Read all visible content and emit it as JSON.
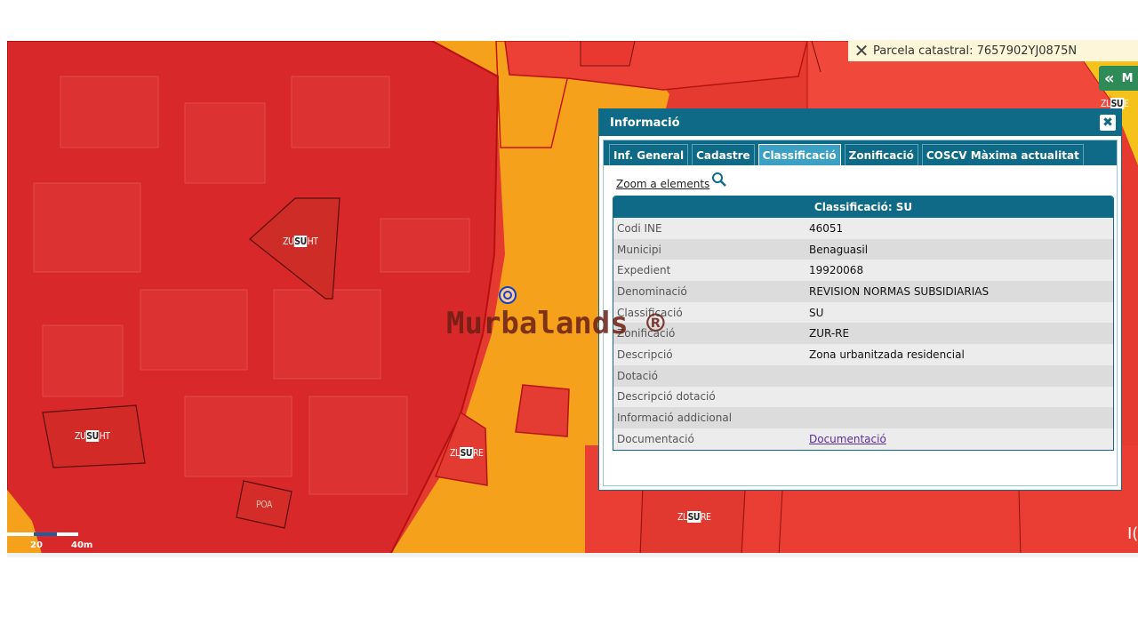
{
  "parcel_bar": {
    "label": "Parcela catastral: 7657902YJ0875N"
  },
  "panel_toggle": {
    "label": "M"
  },
  "info": {
    "title": "Informació",
    "tabs": [
      {
        "label": "Inf. General",
        "active": false
      },
      {
        "label": "Cadastre",
        "active": false
      },
      {
        "label": "Classificació",
        "active": true
      },
      {
        "label": "Zonificació",
        "active": false
      },
      {
        "label": "COSCV Màxima actualitat",
        "active": false
      }
    ],
    "zoom_link": "Zoom a elements",
    "table_header": {
      "prefix": "Classificació:",
      "value": "SU"
    },
    "rows": [
      {
        "key": "Codi INE",
        "value": "46051"
      },
      {
        "key": "Municipi",
        "value": "Benaguasil"
      },
      {
        "key": "Expedient",
        "value": "19920068"
      },
      {
        "key": "Denominació",
        "value": "REVISION NORMAS SUBSIDIARIAS"
      },
      {
        "key": "Classificació",
        "value": "SU"
      },
      {
        "key": "Zonificació",
        "value": "ZUR-RE"
      },
      {
        "key": "Descripció",
        "value": "Zona urbanitzada residencial"
      },
      {
        "key": "Dotació",
        "value": ""
      },
      {
        "key": "Descripció dotació",
        "value": ""
      },
      {
        "key": "Informació addicional",
        "value": ""
      },
      {
        "key": "Documentació",
        "value": "Documentació",
        "link": true
      }
    ]
  },
  "map_labels": {
    "zu_su_ht_1": {
      "pre": "ZU",
      "mid": "SU",
      "post": "HT"
    },
    "zu_su_ht_2": {
      "pre": "ZU",
      "mid": "SU",
      "post": "HT"
    },
    "zl_su_re": {
      "pre": "ZL",
      "mid": "SU",
      "post": "RE"
    },
    "zl_su_re_2": {
      "pre": "ZL",
      "mid": "SU",
      "post": "RE"
    },
    "zl_su_e": {
      "pre": "ZL",
      "mid": "SU",
      "post": "E"
    },
    "poa": "POA"
  },
  "watermark": "Murbalands ®",
  "scale": {
    "label_a": "20",
    "label_b": "40m"
  },
  "edge_text": "I("
}
